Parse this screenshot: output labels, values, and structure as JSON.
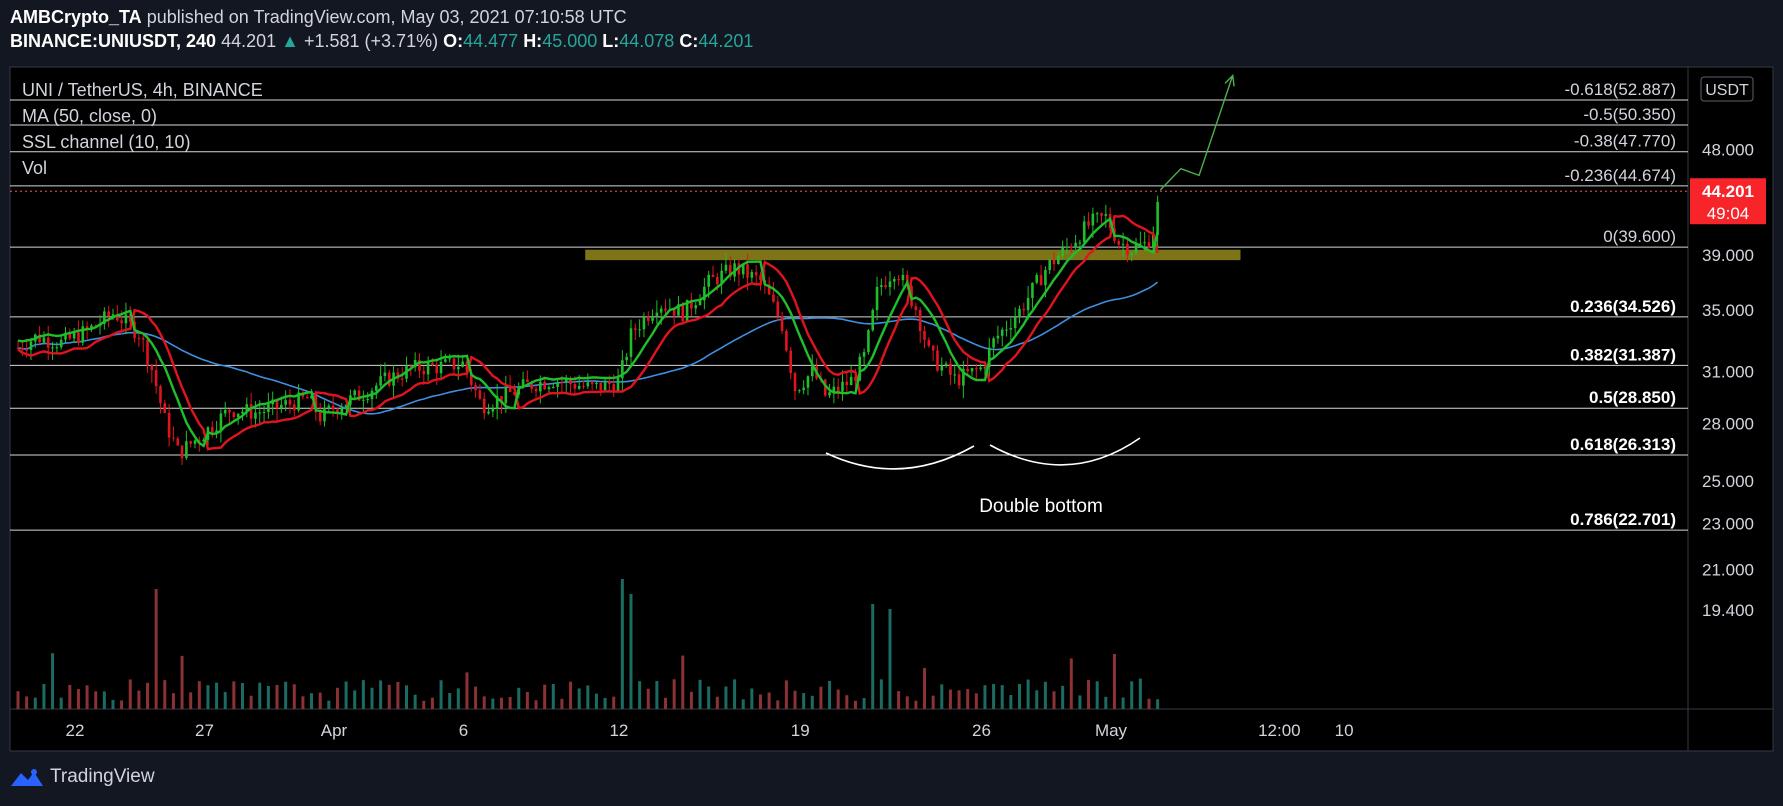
{
  "header": {
    "author": "AMBCrypto_TA",
    "published_text": "published on TradingView.com, May 03, 2021 07:10:58 UTC",
    "symbol": "BINANCE:UNIUSDT, 240",
    "last": "44.201",
    "change_arrow": "▲",
    "change": "+1.581 (+3.71%)",
    "o_label": "O:",
    "o_value": "44.477",
    "h_label": "H:",
    "h_value": "45.000",
    "l_label": "L:",
    "l_value": "44.078",
    "c_label": "C:",
    "c_value": "44.201"
  },
  "legend": {
    "title": "UNI / TetherUS, 4h, BINANCE",
    "ma": "MA (50, close, 0)",
    "ssl": "SSL channel (10, 10)",
    "vol": "Vol"
  },
  "footer": {
    "brand": "TradingView",
    "logo_icon": "tradingview-logo-icon"
  },
  "colors": {
    "background": "#131722",
    "up": "#26a69a",
    "down": "#ef5350",
    "ssl_green": "#1fbf2b",
    "ssl_red": "#e0141e",
    "ma_blue": "#3d8fe0",
    "zone": "#7d7417",
    "price_label_bg": "#f7252a"
  },
  "chart_data": {
    "type": "candlestick",
    "title": "UNI / TetherUS, 4h, BINANCE",
    "y_axis_unit": "USDT",
    "y_scale": "log",
    "ylim": [
      19.4,
      58
    ],
    "y_ticks": [
      "48.000",
      "39.000",
      "35.000",
      "31.000",
      "28.000",
      "25.000",
      "23.000",
      "21.000",
      "19.400"
    ],
    "x_ticks": [
      "22",
      "27",
      "Apr",
      "6",
      "12",
      "19",
      "26",
      "May",
      "12:00",
      "10"
    ],
    "x_tick_days": [
      0,
      5,
      10,
      15,
      21,
      28,
      35,
      40,
      46.5,
      49
    ],
    "last_price": "44.201",
    "countdown": "49:04",
    "fib_levels": [
      {
        "label": "-0.618(52.887)",
        "value": 52.887
      },
      {
        "label": "-0.5(50.350)",
        "value": 50.35
      },
      {
        "label": "-0.38(47.770)",
        "value": 47.77
      },
      {
        "label": "-0.236(44.674)",
        "value": 44.674
      },
      {
        "label": "0(39.600)",
        "value": 39.6
      },
      {
        "label": "0.236(34.526)",
        "value": 34.526
      },
      {
        "label": "0.382(31.387)",
        "value": 31.387
      },
      {
        "label": "0.5(28.850)",
        "value": 28.85
      },
      {
        "label": "0.618(26.313)",
        "value": 26.313
      },
      {
        "label": "0.786(22.701)",
        "value": 22.701
      }
    ],
    "resistance_zone": {
      "from_day": 19.7,
      "to_day": 45.0,
      "low": 38.6,
      "high": 39.4
    },
    "annotation": "Double bottom",
    "projection": [
      {
        "day": 41.9,
        "value": 44.3
      },
      {
        "day": 42.7,
        "value": 46.2
      },
      {
        "day": 43.4,
        "value": 45.6
      },
      {
        "day": 44.7,
        "value": 55.5
      }
    ],
    "close_path": [
      {
        "day": -2.2,
        "value": 32.5
      },
      {
        "day": -1.5,
        "value": 33.2
      },
      {
        "day": -0.5,
        "value": 32.8
      },
      {
        "day": 0.5,
        "value": 33.6
      },
      {
        "day": 1.5,
        "value": 34.8
      },
      {
        "day": 2.5,
        "value": 33.4
      },
      {
        "day": 3.0,
        "value": 31.0
      },
      {
        "day": 3.5,
        "value": 28.0
      },
      {
        "day": 4.0,
        "value": 26.4
      },
      {
        "day": 5.0,
        "value": 27.5
      },
      {
        "day": 6.0,
        "value": 28.8
      },
      {
        "day": 7.0,
        "value": 28.6
      },
      {
        "day": 8.0,
        "value": 29.0
      },
      {
        "day": 9.0,
        "value": 29.4
      },
      {
        "day": 9.5,
        "value": 28.3
      },
      {
        "day": 10.0,
        "value": 28.9
      },
      {
        "day": 11.0,
        "value": 29.6
      },
      {
        "day": 12.0,
        "value": 30.5
      },
      {
        "day": 13.0,
        "value": 31.2
      },
      {
        "day": 14.0,
        "value": 31.3
      },
      {
        "day": 15.0,
        "value": 31.5
      },
      {
        "day": 15.7,
        "value": 29.0
      },
      {
        "day": 16.5,
        "value": 29.5
      },
      {
        "day": 17.5,
        "value": 30.2
      },
      {
        "day": 18.5,
        "value": 30.5
      },
      {
        "day": 20.0,
        "value": 30.0
      },
      {
        "day": 21.0,
        "value": 30.4
      },
      {
        "day": 21.5,
        "value": 33.5
      },
      {
        "day": 22.5,
        "value": 35.5
      },
      {
        "day": 23.5,
        "value": 34.8
      },
      {
        "day": 24.5,
        "value": 37.0
      },
      {
        "day": 25.5,
        "value": 38.0
      },
      {
        "day": 26.5,
        "value": 37.0
      },
      {
        "day": 27.3,
        "value": 34.0
      },
      {
        "day": 27.8,
        "value": 30.0
      },
      {
        "day": 28.5,
        "value": 31.0
      },
      {
        "day": 29.0,
        "value": 29.5
      },
      {
        "day": 30.0,
        "value": 30.5
      },
      {
        "day": 30.5,
        "value": 32.0
      },
      {
        "day": 31.0,
        "value": 36.5
      },
      {
        "day": 31.7,
        "value": 38.0
      },
      {
        "day": 32.5,
        "value": 35.0
      },
      {
        "day": 33.0,
        "value": 32.0
      },
      {
        "day": 34.0,
        "value": 30.5
      },
      {
        "day": 35.0,
        "value": 31.2
      },
      {
        "day": 35.5,
        "value": 33.0
      },
      {
        "day": 36.5,
        "value": 35.0
      },
      {
        "day": 37.5,
        "value": 38.0
      },
      {
        "day": 38.5,
        "value": 40.0
      },
      {
        "day": 39.2,
        "value": 41.5
      },
      {
        "day": 39.8,
        "value": 42.0
      },
      {
        "day": 40.3,
        "value": 40.0
      },
      {
        "day": 40.8,
        "value": 39.5
      },
      {
        "day": 41.3,
        "value": 39.8
      },
      {
        "day": 41.6,
        "value": 40.5
      },
      {
        "day": 41.9,
        "value": 44.2
      }
    ]
  }
}
